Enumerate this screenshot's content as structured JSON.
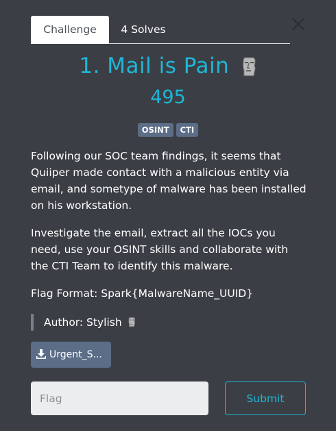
{
  "tabs": [
    {
      "label": "Challenge"
    },
    {
      "label": "4 Solves"
    }
  ],
  "challenge": {
    "title": "1. Mail is Pain",
    "title_emoji_icon": "moai-icon",
    "points": "495",
    "tags": [
      "OSINT",
      "CTI"
    ],
    "description": [
      "Following our SOC team findings, it seems that Quiiper made contact with a malicious entity via email, and sometype of malware has been installed on his workstation.",
      "Investigate the email, extract all the IOCs you need, use your OSINT skills and collaborate with the CTI Team to identify this malware.",
      "Flag Format: Spark{MalwareName_UUID}"
    ],
    "author": "Author: Stylish",
    "author_emoji_icon": "moai-icon"
  },
  "file": {
    "label": "Urgent_S...",
    "icon": "download-icon"
  },
  "form": {
    "flag_placeholder": "Flag",
    "flag_value": "",
    "submit_label": "Submit"
  },
  "colors": {
    "background": "#3b3f45",
    "accent": "#1fb6d6",
    "tag": "#5b6d87"
  }
}
